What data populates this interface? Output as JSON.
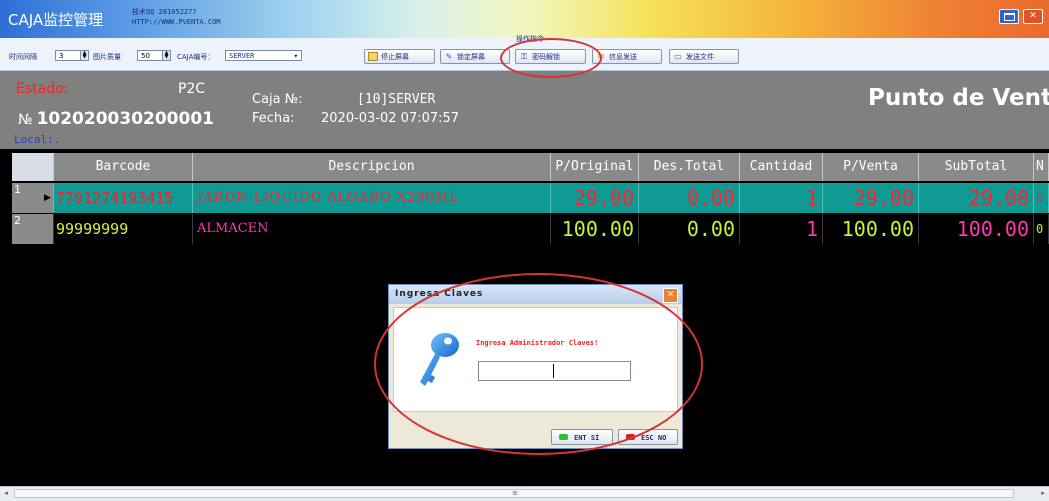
{
  "window": {
    "title": "CAJA监控管理",
    "tech_line1": "技术QQ 281052277",
    "tech_line2": "HTTP://WWW.PVENTA.COM"
  },
  "toolbar": {
    "ops_label": "操作指令",
    "interval_label": "时间间隔",
    "interval_value": "3",
    "image_qty_label": "图片质量",
    "image_qty_value": "50",
    "caja_label": "CAJA编号：",
    "caja_value": "SERVER",
    "btn_stop": "停止屏幕",
    "btn_lock": "锁定屏幕",
    "btn_unlock": "密码解锁",
    "btn_msg": "信息发送",
    "btn_file": "发送文件"
  },
  "info": {
    "estado_label": "Estado:",
    "p2c": "P2C",
    "no_prefix": "№",
    "ticket_no": "102020030200001",
    "caja_label": "Caja №:",
    "caja_value": "[10]SERVER",
    "fecha_label": "Fecha:",
    "fecha_value": "2020-03-02 07:07:57",
    "title": "Punto de Venta",
    "local_label": "Local:."
  },
  "grid": {
    "headers": [
      "Barcode",
      "Descripcion",
      "P/Original",
      "Des.Total",
      "Cantidad",
      "P/Venta",
      "SubTotal",
      "N"
    ],
    "rows": [
      {
        "num": "1",
        "barcode": "7791274193415",
        "descripcion": "JABON LIQUIDO ALGABO X296ML",
        "p_original": "29.00",
        "des_total": "0.00",
        "cantidad": "1",
        "p_venta": "29.00",
        "subtotal": "29.00",
        "n": "0"
      },
      {
        "num": "2",
        "barcode": "99999999",
        "descripcion": "ALMACEN",
        "p_original": "100.00",
        "des_total": "0.00",
        "cantidad": "1",
        "p_venta": "100.00",
        "subtotal": "100.00",
        "n": "0"
      }
    ]
  },
  "dialog": {
    "title": "Ingresa Claves",
    "message": "Ingresa Administrador Claves!",
    "password_value": "",
    "btn_ok": "ENT SÍ",
    "btn_cancel": "ESC NO"
  },
  "colors": {
    "accent_red": "#d63333",
    "row_selected": "#0f9a94"
  }
}
